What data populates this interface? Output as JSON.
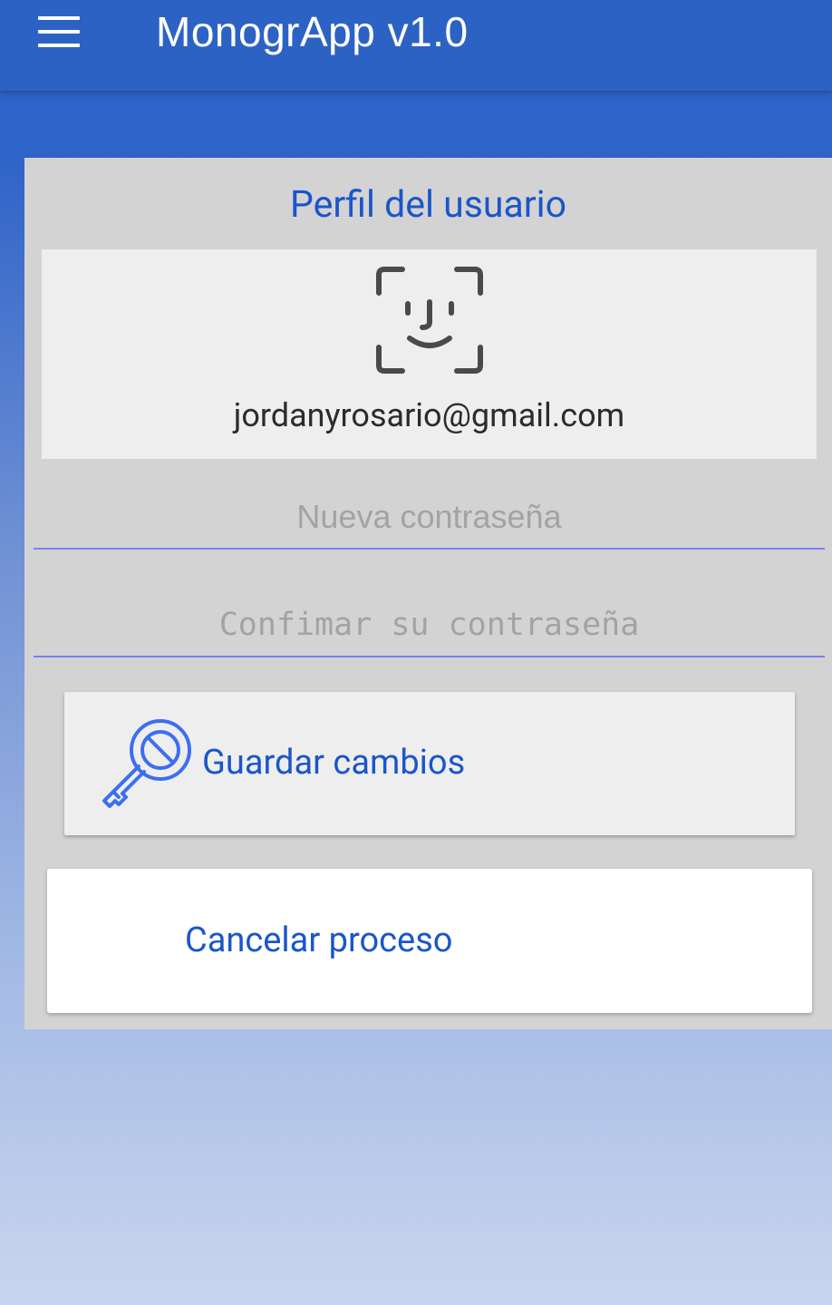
{
  "app_bar": {
    "title": "MonogrApp v1.0",
    "menu_icon": "hamburger-menu-icon"
  },
  "profile": {
    "section_title": "Perfil del usuario",
    "avatar_icon": "face-id-icon",
    "email": "jordanyrosario@gmail.com"
  },
  "form": {
    "new_password_placeholder": "Nueva contraseña",
    "confirm_password_placeholder": "Confimar su contraseña"
  },
  "actions": {
    "save_label": "Guardar cambios",
    "save_icon": "key-icon",
    "cancel_label": "Cancelar proceso"
  },
  "colors": {
    "app_bar": "#2d62c5",
    "accent_text": "#1a56c9",
    "input_underline": "#7b7ff0",
    "panel": "#d4d3d4",
    "card": "#efeeef"
  }
}
